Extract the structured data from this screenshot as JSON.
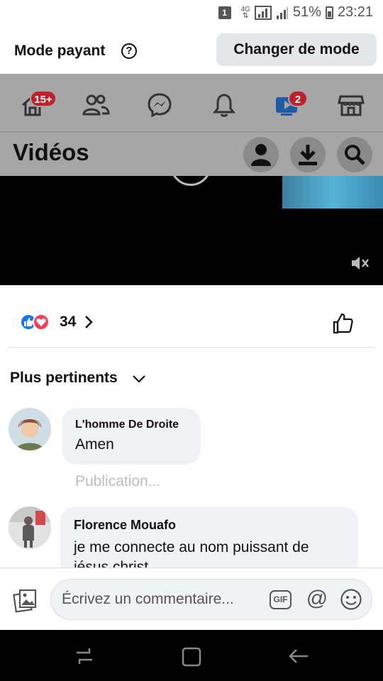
{
  "status_bar": {
    "sim": "1",
    "network": "4G",
    "battery": "51%",
    "time": "23:21"
  },
  "mode_bar": {
    "label": "Mode payant",
    "help_icon": "question-circle-icon",
    "change_button": "Changer de mode"
  },
  "fb_nav": {
    "tabs": [
      {
        "name": "home",
        "icon": "home-icon",
        "badge": "15+"
      },
      {
        "name": "friends",
        "icon": "friends-icon"
      },
      {
        "name": "messenger",
        "icon": "messenger-icon"
      },
      {
        "name": "notifications",
        "icon": "bell-icon"
      },
      {
        "name": "watch",
        "icon": "video-icon",
        "badge": "2",
        "active": true
      },
      {
        "name": "marketplace",
        "icon": "store-icon"
      }
    ]
  },
  "videos_header": {
    "title": "Vidéos",
    "actions": [
      "profile-icon",
      "download-icon",
      "search-icon"
    ]
  },
  "video": {
    "muted": true
  },
  "comments_sheet": {
    "reactions": {
      "types": [
        "like",
        "love"
      ],
      "count": "34"
    },
    "sort": "Plus pertinents",
    "comments": [
      {
        "author": "L'homme De Droite",
        "text": "Amen",
        "status": "Publication..."
      },
      {
        "author": "Florence Mouafo",
        "text_line1": "je me connecte au nom puissant de",
        "text_line2": "jésus christ"
      }
    ],
    "composer": {
      "placeholder": "Écrivez un commentaire...",
      "gif": "GIF",
      "at": "@"
    }
  },
  "colors": {
    "fb_blue": "#1877f2",
    "badge_red": "#c0202c",
    "love_red": "#f33e58"
  }
}
